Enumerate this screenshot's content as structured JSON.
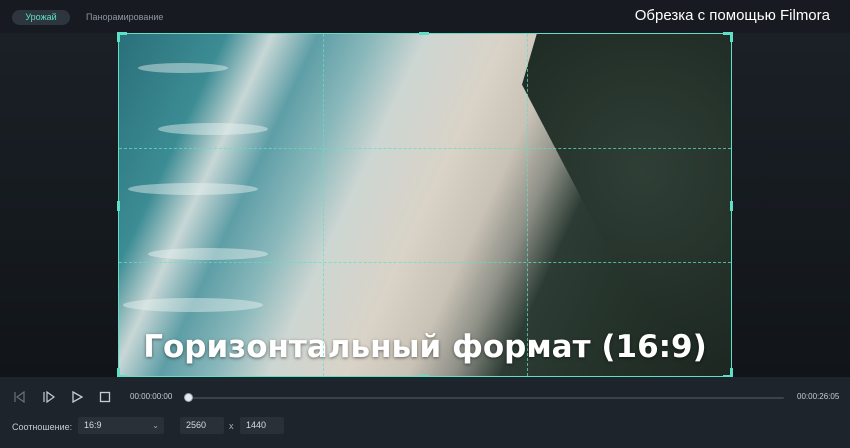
{
  "header": {
    "tabs": [
      {
        "label": "Урожай",
        "active": true
      },
      {
        "label": "Панорамирование",
        "active": false
      }
    ],
    "title": "Обрезка с помощью Filmora"
  },
  "preview": {
    "caption": "Горизонтальный формат (16:9)",
    "accent_color": "#5fe0c6"
  },
  "player": {
    "current_time": "00:00:00:00",
    "total_time": "00:00:26:05",
    "progress": 0,
    "icons": [
      "prev-frame-icon",
      "next-frame-icon",
      "play-icon",
      "stop-icon"
    ]
  },
  "settings": {
    "ratio_label": "Соотношение:",
    "ratio_value": "16:9",
    "width": "2560",
    "separator": "x",
    "height": "1440"
  }
}
